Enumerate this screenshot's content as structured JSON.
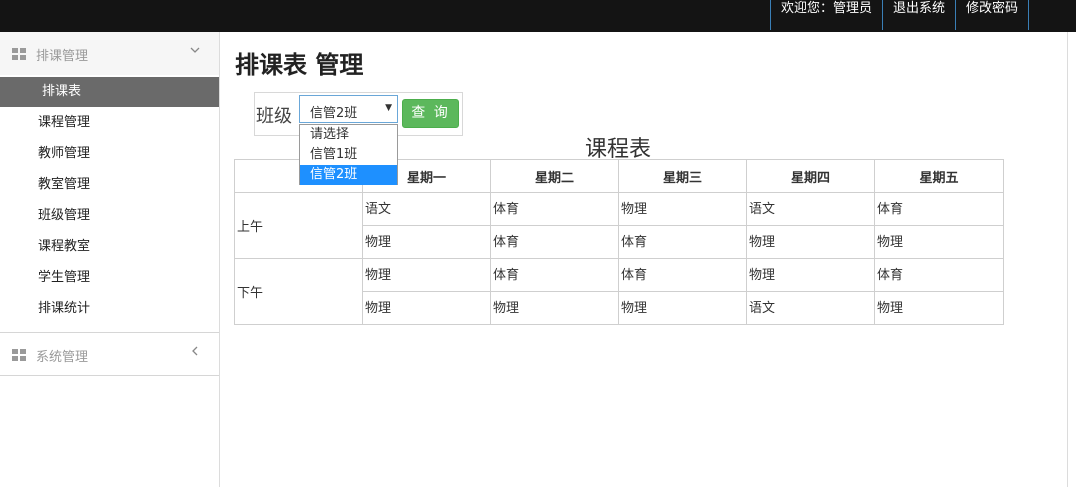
{
  "topbar": {
    "welcome": "欢迎您：管理员",
    "logout": "退出系统",
    "change_password": "修改密码"
  },
  "sidebar": {
    "group1": {
      "title": "排课管理",
      "icon": "grid-icon",
      "chevron": "chevron-down-icon"
    },
    "items": [
      {
        "label": "排课表",
        "active": true
      },
      {
        "label": "课程管理"
      },
      {
        "label": "教师管理"
      },
      {
        "label": "教室管理"
      },
      {
        "label": "班级管理"
      },
      {
        "label": "课程教室"
      },
      {
        "label": "学生管理"
      },
      {
        "label": "排课统计"
      }
    ],
    "group2": {
      "title": "系统管理",
      "icon": "grid-icon",
      "chevron": "chevron-left-icon"
    }
  },
  "main": {
    "title": "排课表 管理",
    "filter": {
      "label": "班级",
      "selected": "信管2班",
      "options": [
        "请选择",
        "信管1班",
        "信管2班"
      ],
      "query_button": "查 询"
    },
    "table_title": "课程表",
    "table": {
      "headers": [
        "",
        "星期一",
        "星期二",
        "星期三",
        "星期四",
        "星期五"
      ],
      "periods": [
        {
          "name": "上午",
          "rows": [
            [
              "语文",
              "体育",
              "物理",
              "语文",
              "体育"
            ],
            [
              "物理",
              "体育",
              "体育",
              "物理",
              "物理"
            ]
          ]
        },
        {
          "name": "下午",
          "rows": [
            [
              "物理",
              "体育",
              "体育",
              "物理",
              "体育"
            ],
            [
              "物理",
              "物理",
              "物理",
              "语文",
              "物理"
            ]
          ]
        }
      ]
    }
  },
  "colors": {
    "topbar_bg": "#141414",
    "active_menu_bg": "#6a6a6a",
    "query_button_bg": "#5cb85c",
    "dropdown_selected_bg": "#1e90ff"
  }
}
